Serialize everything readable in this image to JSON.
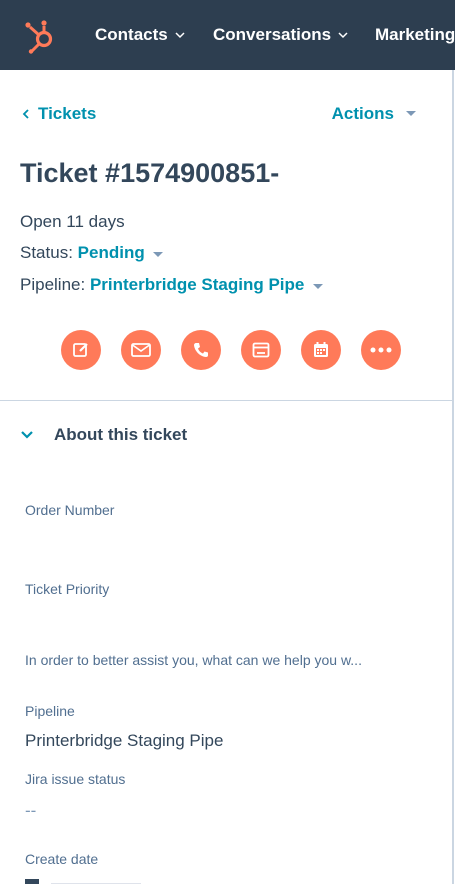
{
  "nav": {
    "logo_icon": "hubspot-sprocket-icon",
    "items": [
      {
        "label": "Contacts"
      },
      {
        "label": "Conversations"
      },
      {
        "label": "Marketing"
      }
    ]
  },
  "breadcrumb": {
    "back_label": "Tickets",
    "back_icon": "chevron-left-icon"
  },
  "actions": {
    "label": "Actions"
  },
  "ticket": {
    "title": "Ticket #1574900851-",
    "open_duration": "Open 11 days",
    "status_label": "Status:",
    "status_value": "Pending",
    "pipeline_label": "Pipeline:",
    "pipeline_value": "Printerbridge Staging Pipe"
  },
  "action_buttons": [
    {
      "icon": "note-edit-icon"
    },
    {
      "icon": "email-icon"
    },
    {
      "icon": "phone-icon"
    },
    {
      "icon": "task-icon"
    },
    {
      "icon": "meeting-calendar-icon"
    },
    {
      "icon": "more-icon"
    }
  ],
  "about": {
    "title": "About this ticket",
    "fields": {
      "order_number": {
        "label": "Order Number",
        "value": ""
      },
      "ticket_priority": {
        "label": "Ticket Priority",
        "value": ""
      },
      "description": {
        "label": "In order to better assist you, what can we help you w..."
      },
      "pipeline": {
        "label": "Pipeline",
        "value": "Printerbridge Staging Pipe"
      },
      "jira_status": {
        "label": "Jira issue status",
        "value": "--"
      },
      "create_date": {
        "label": "Create date"
      }
    }
  },
  "colors": {
    "nav_bg": "#2d3e50",
    "accent_teal": "#0091ae",
    "action_orange": "#ff7a59",
    "text_dark": "#33475b",
    "text_muted": "#516f90",
    "border": "#cbd6e2"
  }
}
